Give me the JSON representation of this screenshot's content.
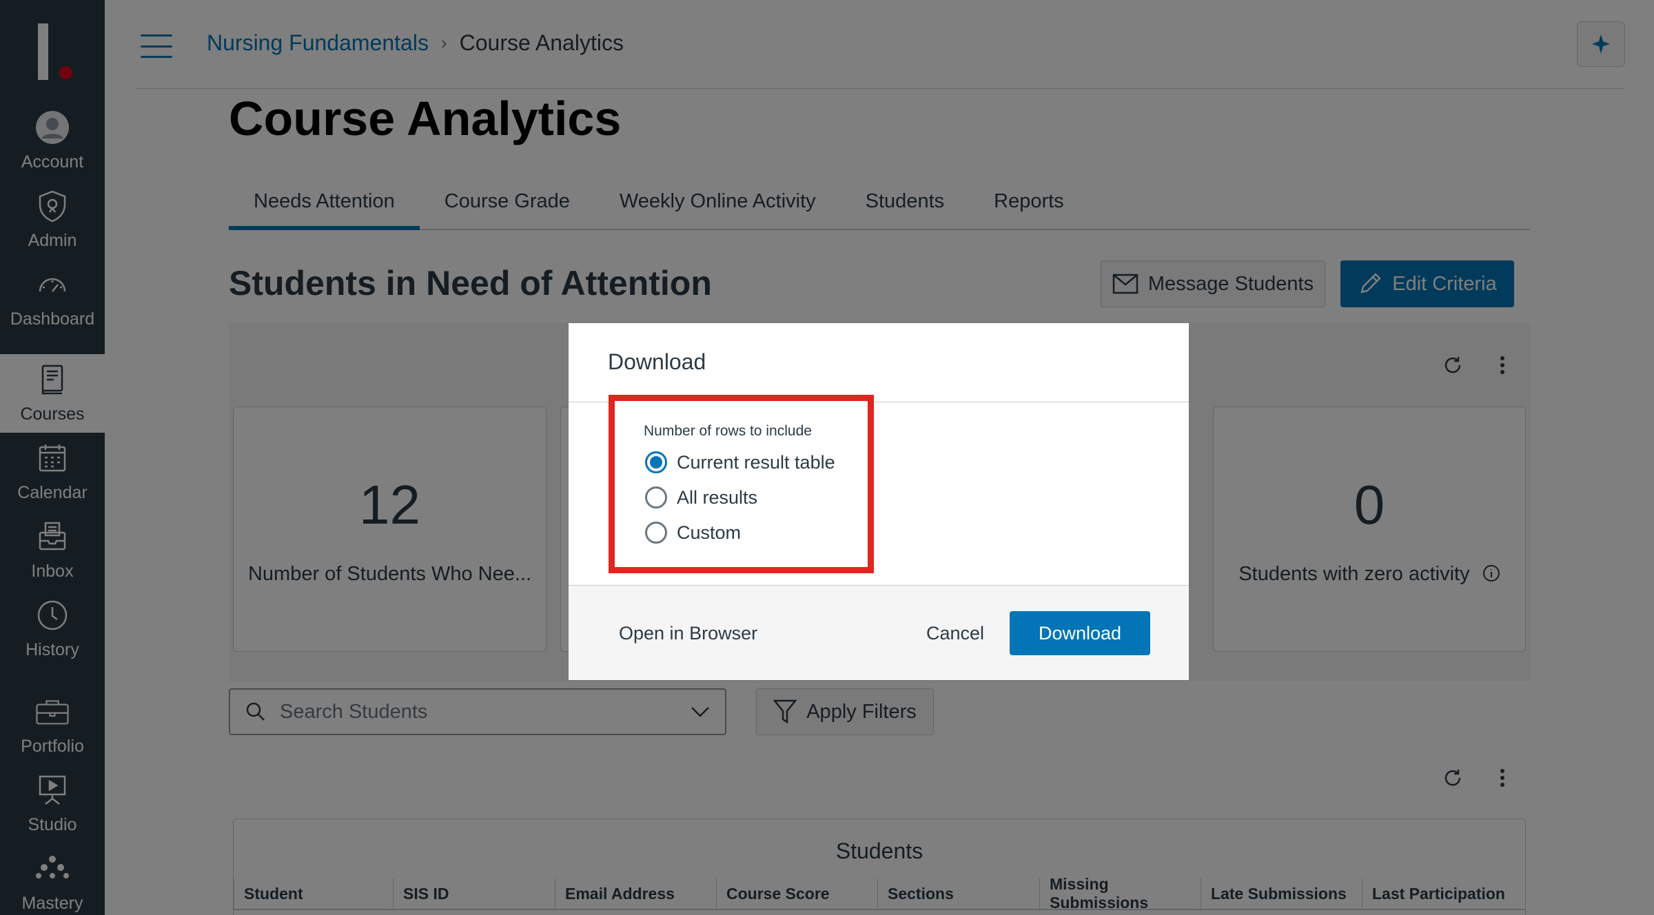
{
  "nav": {
    "items": [
      {
        "label": "Account",
        "icon": "account-icon"
      },
      {
        "label": "Admin",
        "icon": "admin-icon"
      },
      {
        "label": "Dashboard",
        "icon": "dashboard-icon"
      },
      {
        "label": "Courses",
        "icon": "courses-icon",
        "active": true
      },
      {
        "label": "Calendar",
        "icon": "calendar-icon"
      },
      {
        "label": "Inbox",
        "icon": "inbox-icon"
      },
      {
        "label": "History",
        "icon": "history-icon"
      },
      {
        "label": "Portfolio",
        "icon": "portfolio-icon"
      },
      {
        "label": "Studio",
        "icon": "studio-icon"
      },
      {
        "label": "Mastery",
        "icon": "mastery-icon"
      }
    ]
  },
  "header": {
    "breadcrumb_course": "Nursing Fundamentals",
    "breadcrumb_sep": "›",
    "breadcrumb_current": "Course Analytics"
  },
  "page": {
    "title": "Course Analytics",
    "tabs": [
      "Needs Attention",
      "Course Grade",
      "Weekly Online Activity",
      "Students",
      "Reports"
    ],
    "section_title": "Students in Need of Attention",
    "message_students": "Message Students",
    "edit_criteria": "Edit Criteria"
  },
  "stats": [
    {
      "value": "12",
      "label": "Number of Students Who Nee..."
    },
    {
      "value": "0",
      "label": "Students with zero activity"
    }
  ],
  "search": {
    "placeholder": "Search Students"
  },
  "apply_filters": "Apply Filters",
  "table": {
    "caption": "Students",
    "columns": [
      "Student",
      "SIS ID",
      "Email Address",
      "Course Score",
      "Sections",
      "Missing Submissions",
      "Late Submissions",
      "Last Participation"
    ]
  },
  "modal": {
    "title": "Download",
    "group_label": "Number of rows to include",
    "options": [
      "Current result table",
      "All results",
      "Custom"
    ],
    "selected_index": 0,
    "open_in_browser": "Open in Browser",
    "cancel": "Cancel",
    "download": "Download"
  },
  "colors": {
    "nav_bg": "#2d3b45",
    "brand_blue": "#0374b5",
    "highlight_red": "#e0261f"
  }
}
